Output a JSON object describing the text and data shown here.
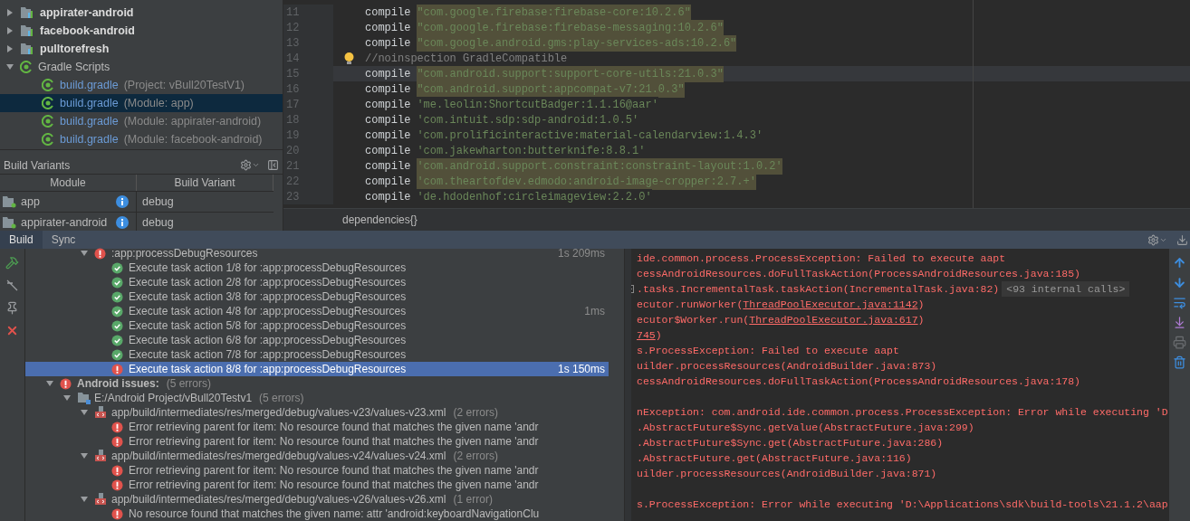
{
  "project_tree": [
    {
      "label": "appirater-android",
      "kind": "module",
      "expanded": false,
      "selected": false
    },
    {
      "label": "facebook-android",
      "kind": "module",
      "expanded": false,
      "selected": false
    },
    {
      "label": "pulltorefresh",
      "kind": "module",
      "expanded": false,
      "selected": false
    },
    {
      "label": "Gradle Scripts",
      "kind": "group",
      "expanded": true,
      "selected": false,
      "children": [
        {
          "label": "build.gradle",
          "detail": "(Project: vBull20TestV1)",
          "kind": "gradle",
          "selected": false
        },
        {
          "label": "build.gradle",
          "detail": "(Module: app)",
          "kind": "gradle",
          "selected": true
        },
        {
          "label": "build.gradle",
          "detail": "(Module: appirater-android)",
          "kind": "gradle",
          "selected": false
        },
        {
          "label": "build.gradle",
          "detail": "(Module: facebook-android)",
          "kind": "gradle",
          "selected": false
        }
      ]
    }
  ],
  "build_variants": {
    "title": "Build Variants",
    "columns": [
      "Module",
      "Build Variant"
    ],
    "rows": [
      {
        "module": "app",
        "variant": "debug"
      },
      {
        "module": "appirater-android",
        "variant": "debug"
      }
    ]
  },
  "editor": {
    "lines": [
      {
        "number": "11",
        "kind": "compile",
        "keyword": "compile",
        "value": "\"com.google.firebase:firebase-core:10.2.6\"",
        "highlighted": true,
        "current": false,
        "bulb": false
      },
      {
        "number": "12",
        "kind": "compile",
        "keyword": "compile",
        "value": "\"com.google.firebase:firebase-messaging:10.2.6\"",
        "highlighted": true,
        "current": false,
        "bulb": false
      },
      {
        "number": "13",
        "kind": "compile",
        "keyword": "compile",
        "value": "\"com.google.android.gms:play-services-ads:10.2.6\"",
        "highlighted": true,
        "current": false,
        "bulb": false
      },
      {
        "number": "14",
        "kind": "comment",
        "value": "//noinspection GradleCompatible",
        "highlighted": false,
        "current": false,
        "bulb": true
      },
      {
        "number": "15",
        "kind": "compile",
        "keyword": "compile",
        "value": "\"com.android.support:support-core-utils:21.0.3\"",
        "highlighted": true,
        "current": true,
        "bulb": false
      },
      {
        "number": "16",
        "kind": "compile",
        "keyword": "compile",
        "value": "\"com.android.support:appcompat-v7:21.0.3\"",
        "highlighted": true,
        "current": false,
        "bulb": false
      },
      {
        "number": "17",
        "kind": "compile",
        "keyword": "compile",
        "value": "'me.leolin:ShortcutBadger:1.1.16@aar'",
        "highlighted": false,
        "current": false,
        "bulb": false
      },
      {
        "number": "18",
        "kind": "compile",
        "keyword": "compile",
        "value": "'com.intuit.sdp:sdp-android:1.0.5'",
        "highlighted": false,
        "current": false,
        "bulb": false
      },
      {
        "number": "19",
        "kind": "compile",
        "keyword": "compile",
        "value": "'com.prolificinteractive:material-calendarview:1.4.3'",
        "highlighted": false,
        "current": false,
        "bulb": false
      },
      {
        "number": "20",
        "kind": "compile",
        "keyword": "compile",
        "value": "'com.jakewharton:butterknife:8.8.1'",
        "highlighted": false,
        "current": false,
        "bulb": false
      },
      {
        "number": "21",
        "kind": "compile",
        "keyword": "compile",
        "value": "'com.android.support.constraint:constraint-layout:1.0.2'",
        "highlighted": true,
        "current": false,
        "bulb": false
      },
      {
        "number": "22",
        "kind": "compile",
        "keyword": "compile",
        "value": "'com.theartofdev.edmodo:android-image-cropper:2.7.+'",
        "highlighted": true,
        "current": false,
        "bulb": false
      },
      {
        "number": "23",
        "kind": "compile",
        "keyword": "compile",
        "value": "'de.hdodenhof:circleimageview:2.2.0'",
        "highlighted": false,
        "current": false,
        "bulb": false
      }
    ],
    "breadcrumb": "dependencies{}"
  },
  "tool_tabs": [
    {
      "label": "Build",
      "selected": true
    },
    {
      "label": "Sync",
      "selected": false
    }
  ],
  "build_tree": [
    {
      "kind": "task",
      "error": true,
      "label": ":app:processDebugResources",
      "time": "1s 209ms",
      "expanded": true,
      "selected": false,
      "children": [
        {
          "kind": "entry",
          "error": false,
          "label": "Execute task action 1/8 for :app:processDebugResources",
          "selected": false
        },
        {
          "kind": "entry",
          "error": false,
          "label": "Execute task action 2/8 for :app:processDebugResources",
          "selected": false
        },
        {
          "kind": "entry",
          "error": false,
          "label": "Execute task action 3/8 for :app:processDebugResources",
          "selected": false
        },
        {
          "kind": "entry",
          "error": false,
          "label": "Execute task action 4/8 for :app:processDebugResources",
          "time": "1ms",
          "selected": false
        },
        {
          "kind": "entry",
          "error": false,
          "label": "Execute task action 5/8 for :app:processDebugResources",
          "selected": false
        },
        {
          "kind": "entry",
          "error": false,
          "label": "Execute task action 6/8 for :app:processDebugResources",
          "selected": false
        },
        {
          "kind": "entry",
          "error": false,
          "label": "Execute task action 7/8 for :app:processDebugResources",
          "selected": false
        },
        {
          "kind": "entry",
          "error": true,
          "label": "Execute task action 8/8 for :app:processDebugResources",
          "time": "1s 150ms",
          "selected": true
        }
      ]
    },
    {
      "kind": "category",
      "error": true,
      "label": "Android issues:",
      "count": "(5 errors)",
      "expanded": true,
      "selected": false,
      "children": [
        {
          "kind": "folder",
          "label": "E:/Android Project/vBull20Testv1",
          "count": "(5 errors)",
          "expanded": true,
          "selected": false,
          "children": [
            {
              "kind": "file",
              "label": "app/build/intermediates/res/merged/debug/values-v23/values-v23.xml",
              "count": "(2 errors)",
              "expanded": true,
              "selected": false,
              "children": [
                {
                  "kind": "entry",
                  "error": true,
                  "label": "Error retrieving parent for item: No resource found that matches the given name 'andr",
                  "selected": false
                },
                {
                  "kind": "entry",
                  "error": true,
                  "label": "Error retrieving parent for item: No resource found that matches the given name 'andr",
                  "selected": false
                }
              ]
            },
            {
              "kind": "file",
              "label": "app/build/intermediates/res/merged/debug/values-v24/values-v24.xml",
              "count": "(2 errors)",
              "expanded": true,
              "selected": false,
              "children": [
                {
                  "kind": "entry",
                  "error": true,
                  "label": "Error retrieving parent for item: No resource found that matches the given name 'andr",
                  "selected": false
                },
                {
                  "kind": "entry",
                  "error": true,
                  "label": "Error retrieving parent for item: No resource found that matches the given name 'andr",
                  "selected": false
                }
              ]
            },
            {
              "kind": "file",
              "label": "app/build/intermediates/res/merged/debug/values-v26/values-v26.xml",
              "count": "(1 error)",
              "expanded": true,
              "selected": false,
              "children": [
                {
                  "kind": "entry",
                  "error": true,
                  "label": "No resource found that matches the given name: attr 'android:keyboardNavigationClu",
                  "selected": false
                }
              ]
            }
          ]
        }
      ]
    }
  ],
  "console": [
    {
      "kind": "text",
      "foldable": false,
      "segments": [
        {
          "kind": "text",
          "text": "ide.common.process.ProcessException: Failed to execute aapt"
        }
      ]
    },
    {
      "kind": "text",
      "foldable": false,
      "segments": [
        {
          "kind": "text",
          "text": "cessAndroidResources.doFullTaskAction(ProcessAndroidResources.java:185)"
        }
      ]
    },
    {
      "kind": "text",
      "foldable": true,
      "segments": [
        {
          "kind": "text",
          "text": ".tasks.IncrementalTask.taskAction(IncrementalTask.java:82)"
        },
        {
          "kind": "badge",
          "text": "<93 internal calls>"
        }
      ]
    },
    {
      "kind": "text",
      "foldable": false,
      "segments": [
        {
          "kind": "text",
          "text": "ecutor.runWorker("
        },
        {
          "kind": "link",
          "text": "ThreadPoolExecutor.java:1142"
        },
        {
          "kind": "text",
          "text": ")"
        }
      ]
    },
    {
      "kind": "text",
      "foldable": false,
      "segments": [
        {
          "kind": "text",
          "text": "ecutor$Worker.run("
        },
        {
          "kind": "link",
          "text": "ThreadPoolExecutor.java:617"
        },
        {
          "kind": "text",
          "text": ")"
        }
      ]
    },
    {
      "kind": "text",
      "foldable": false,
      "segments": [
        {
          "kind": "link",
          "text": "745"
        },
        {
          "kind": "text",
          "text": ")"
        }
      ]
    },
    {
      "kind": "text",
      "foldable": false,
      "segments": [
        {
          "kind": "text",
          "text": "s.ProcessException: Failed to execute aapt"
        }
      ]
    },
    {
      "kind": "text",
      "foldable": false,
      "segments": [
        {
          "kind": "text",
          "text": "uilder.processResources(AndroidBuilder.java:873)"
        }
      ]
    },
    {
      "kind": "text",
      "foldable": false,
      "segments": [
        {
          "kind": "text",
          "text": "cessAndroidResources.doFullTaskAction(ProcessAndroidResources.java:178)"
        }
      ]
    },
    {
      "kind": "blank"
    },
    {
      "kind": "text",
      "foldable": false,
      "segments": [
        {
          "kind": "text",
          "text": "nException: com.android.ide.common.process.ProcessException: Error while executing 'D"
        }
      ]
    },
    {
      "kind": "text",
      "foldable": false,
      "segments": [
        {
          "kind": "text",
          "text": ".AbstractFuture$Sync.getValue(AbstractFuture.java:299)"
        }
      ]
    },
    {
      "kind": "text",
      "foldable": false,
      "segments": [
        {
          "kind": "text",
          "text": ".AbstractFuture$Sync.get(AbstractFuture.java:286)"
        }
      ]
    },
    {
      "kind": "text",
      "foldable": false,
      "segments": [
        {
          "kind": "text",
          "text": ".AbstractFuture.get(AbstractFuture.java:116)"
        }
      ]
    },
    {
      "kind": "text",
      "foldable": false,
      "segments": [
        {
          "kind": "text",
          "text": "uilder.processResources(AndroidBuilder.java:871)"
        }
      ]
    },
    {
      "kind": "blank"
    },
    {
      "kind": "text",
      "foldable": false,
      "segments": [
        {
          "kind": "text",
          "text": "s.ProcessException: Error while executing 'D:\\Applications\\sdk\\build-tools\\21.1.2\\aap"
        }
      ]
    }
  ]
}
